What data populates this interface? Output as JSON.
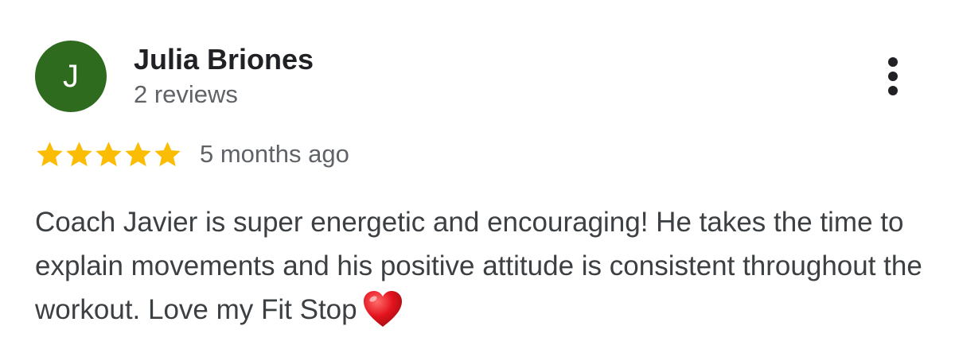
{
  "reviewer": {
    "initial": "J",
    "name": "Julia Briones",
    "review_count": "2 reviews",
    "avatar_color": "#2e6b1e"
  },
  "menu": {
    "icon": "more-vertical-icon"
  },
  "rating": {
    "stars": 5,
    "max_stars": 5,
    "star_color": "#fbbc04",
    "time_ago": "5 months ago"
  },
  "review": {
    "text": "Coach Javier is super energetic and encouraging! He takes the time to explain movements and his positive attitude is consistent throughout the workout. Love my Fit Stop",
    "emoji": "heart-icon"
  }
}
